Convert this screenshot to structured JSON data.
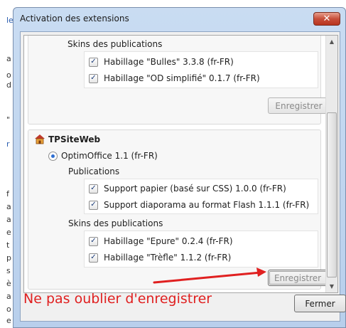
{
  "window": {
    "title": "Activation des extensions",
    "close_glyph": "✕"
  },
  "group1": {
    "skins_title": "Skins des publications",
    "skins": [
      {
        "label": "Habillage \"Bulles\" 3.3.8 (fr-FR)",
        "checked": true
      },
      {
        "label": "Habillage \"OD simplifié\" 0.1.7 (fr-FR)",
        "checked": true
      }
    ],
    "save_label": "Enregistrer"
  },
  "group2": {
    "title": "TPSiteWeb",
    "icon": "site-icon",
    "option_label": "OptimOffice 1.1 (fr-FR)",
    "publications_title": "Publications",
    "publications": [
      {
        "label": "Support papier (basé sur CSS) 1.0.0 (fr-FR)",
        "checked": true
      },
      {
        "label": "Support diaporama au format Flash 1.1.1 (fr-FR)",
        "checked": true
      }
    ],
    "skins_title": "Skins des publications",
    "skins": [
      {
        "label": "Habillage \"Epure\" 0.2.4 (fr-FR)",
        "checked": true
      },
      {
        "label": "Habillage \"Trèfle\" 1.1.2 (fr-FR)",
        "checked": true
      }
    ],
    "save_label": "Enregistrer"
  },
  "footer": {
    "note": "Ne pas oublier d'enregistrer",
    "close_label": "Fermer",
    "note_color": "#e02020"
  },
  "background_chars": [
    "le",
    "a",
    "o",
    "d",
    "\"",
    "r",
    "f",
    "a",
    "a",
    "e",
    "t",
    "p",
    "s",
    "è",
    "a",
    "o",
    "e"
  ]
}
